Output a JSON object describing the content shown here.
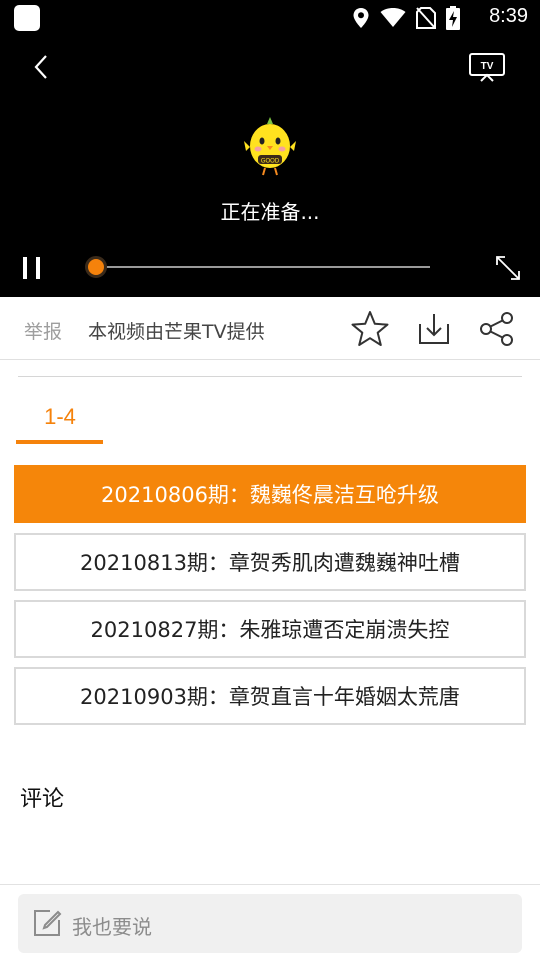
{
  "status_bar": {
    "time": "8:39"
  },
  "player": {
    "mascot_icon": "chicken-mascot-icon",
    "status_text": "正在准备...",
    "progress": 0,
    "accent_color": "#f5820b"
  },
  "actions": {
    "report_label": "举报",
    "provider_text": "本视频由芒果TV提供",
    "icons": [
      "star-icon",
      "download-icon",
      "share-icon"
    ]
  },
  "tabs": [
    {
      "label": "1-4",
      "selected": true
    }
  ],
  "episodes": [
    {
      "title": "20210806期：魏巍佟晨洁互呛升级",
      "active": true
    },
    {
      "title": "20210813期：章贺秀肌肉遭魏巍神吐槽",
      "active": false
    },
    {
      "title": "20210827期：朱雅琼遭否定崩溃失控",
      "active": false
    },
    {
      "title": "20210903期：章贺直言十年婚姻太荒唐",
      "active": false
    }
  ],
  "comments": {
    "title": "评论",
    "input_placeholder": "我也要说"
  }
}
